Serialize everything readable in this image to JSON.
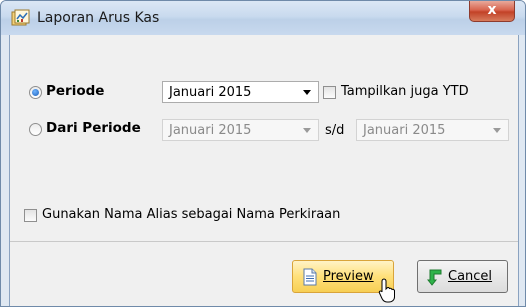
{
  "window": {
    "title": "Laporan Arus Kas",
    "close_label": "x"
  },
  "form": {
    "periode_label": "Periode",
    "periode_value": "Januari 2015",
    "ytd_label": "Tampilkan juga YTD",
    "dari_label": "Dari Periode",
    "dari_value": "Januari 2015",
    "sd_label": "s/d",
    "sampai_value": "Januari 2015",
    "alias_label": "Gunakan Nama Alias sebagai Nama Perkiraan",
    "selected": "periode"
  },
  "buttons": {
    "preview": "Preview",
    "cancel": "Cancel"
  },
  "icons": {
    "title": "report-icon",
    "preview": "document-icon",
    "cancel": "green-arrow-icon"
  },
  "colors": {
    "titlebar": "#c9daee",
    "close": "#c24227",
    "primary_button": "#ffe07a",
    "radio_selected": "#1d5fb8"
  }
}
